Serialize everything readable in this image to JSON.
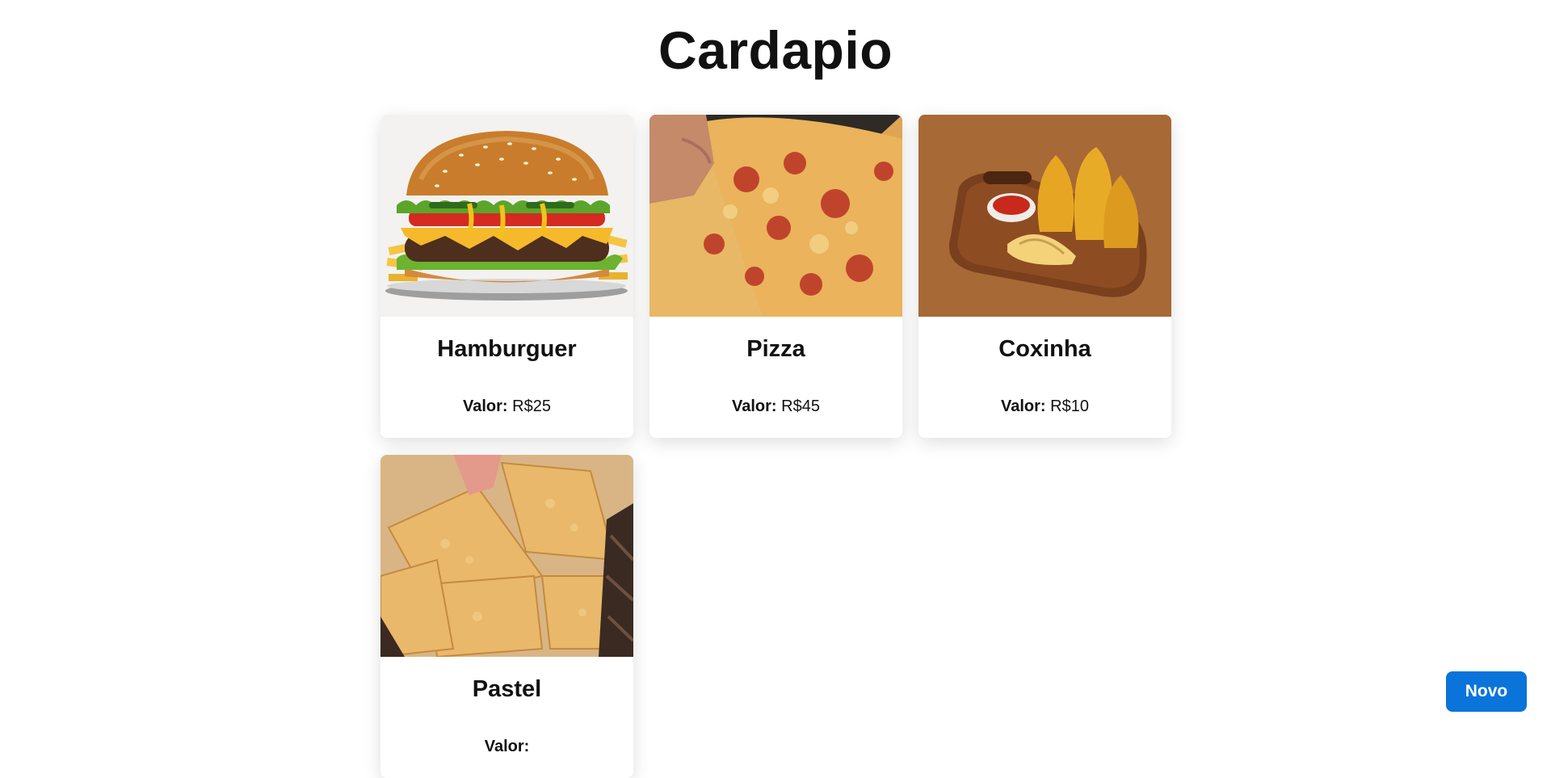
{
  "page": {
    "title": "Cardapio"
  },
  "menu": {
    "price_label": "Valor:",
    "items": [
      {
        "name": "Hamburguer",
        "price": "R$25",
        "image": "hamburger-photo"
      },
      {
        "name": "Pizza",
        "price": "R$45",
        "image": "pizza-photo"
      },
      {
        "name": "Coxinha",
        "price": "R$10",
        "image": "coxinha-photo"
      },
      {
        "name": "Pastel",
        "price": "",
        "image": "pastel-photo"
      }
    ]
  },
  "actions": {
    "new_label": "Novo"
  },
  "colors": {
    "accent": "#0a74da",
    "background": "#ffffff"
  }
}
